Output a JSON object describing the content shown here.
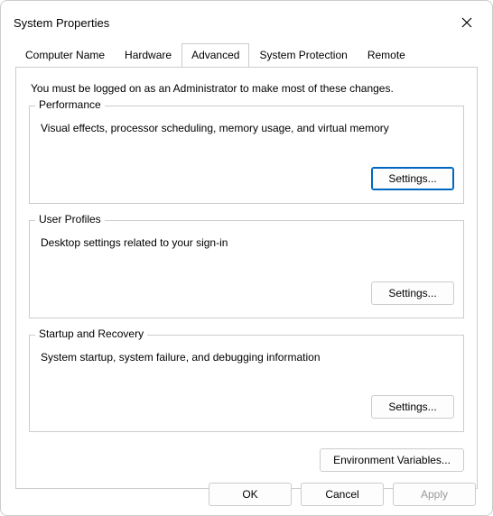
{
  "window": {
    "title": "System Properties"
  },
  "tabs": {
    "computer_name": "Computer Name",
    "hardware": "Hardware",
    "advanced": "Advanced",
    "system_protection": "System Protection",
    "remote": "Remote",
    "active": "advanced"
  },
  "advanced_panel": {
    "admin_note": "You must be logged on as an Administrator to make most of these changes.",
    "performance": {
      "legend": "Performance",
      "desc": "Visual effects, processor scheduling, memory usage, and virtual memory",
      "settings_label": "Settings..."
    },
    "user_profiles": {
      "legend": "User Profiles",
      "desc": "Desktop settings related to your sign-in",
      "settings_label": "Settings..."
    },
    "startup_recovery": {
      "legend": "Startup and Recovery",
      "desc": "System startup, system failure, and debugging information",
      "settings_label": "Settings..."
    },
    "env_vars_label": "Environment Variables..."
  },
  "footer": {
    "ok": "OK",
    "cancel": "Cancel",
    "apply": "Apply"
  }
}
